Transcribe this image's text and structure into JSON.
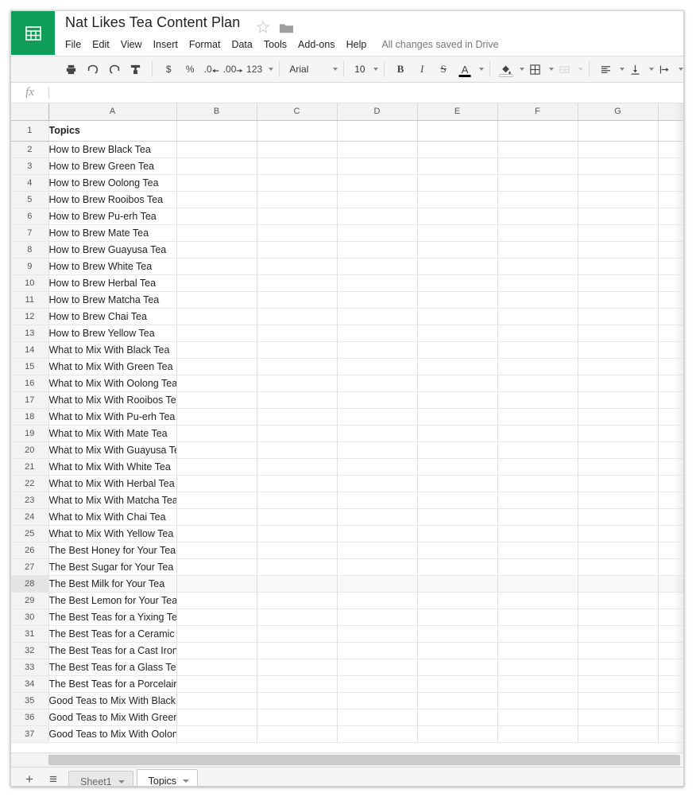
{
  "header": {
    "logo_icon": "sheets-grid-icon",
    "title": "Nat Likes Tea Content Plan",
    "star_icon": "star-outline-icon",
    "folder_icon": "folder-icon",
    "menus": [
      "File",
      "Edit",
      "View",
      "Insert",
      "Format",
      "Data",
      "Tools",
      "Add-ons",
      "Help"
    ],
    "save_status": "All changes saved in Drive"
  },
  "toolbar": {
    "print_icon": "print-icon",
    "undo_icon": "undo-icon",
    "redo_icon": "redo-icon",
    "paint_format_icon": "paint-format-icon",
    "currency_label": "$",
    "percent_label": "%",
    "decrease_decimal_label": ".0",
    "increase_decimal_label": ".00",
    "number_format_label": "123",
    "font_name": "Arial",
    "font_size": "10",
    "bold_label": "B",
    "italic_label": "I",
    "strikethrough_label": "S",
    "text_color_label": "A",
    "text_color_value": "#000000",
    "fill_color_icon": "fill-color-icon",
    "fill_color_value": "#ffffff",
    "borders_icon": "borders-icon",
    "merge_cells_icon": "merge-cells-icon",
    "horizontal_align_icon": "horizontal-align-icon",
    "vertical_align_icon": "vertical-align-icon",
    "text_wrap_icon": "text-wrapping-icon"
  },
  "formula_bar": {
    "fx_label": "fx",
    "value": "",
    "placeholder": ""
  },
  "grid": {
    "corner_label": "",
    "columns": [
      "A",
      "B",
      "C",
      "D",
      "E",
      "F",
      "G"
    ],
    "hover_row": 28,
    "rows": [
      {
        "n": "1",
        "a": "Topics"
      },
      {
        "n": "2",
        "a": "How to Brew Black Tea"
      },
      {
        "n": "3",
        "a": "How to Brew Green Tea"
      },
      {
        "n": "4",
        "a": "How to Brew Oolong Tea"
      },
      {
        "n": "5",
        "a": "How to Brew Rooibos Tea"
      },
      {
        "n": "6",
        "a": "How to Brew Pu-erh Tea"
      },
      {
        "n": "7",
        "a": "How to Brew Mate Tea"
      },
      {
        "n": "8",
        "a": "How to Brew Guayusa Tea"
      },
      {
        "n": "9",
        "a": "How to Brew White Tea"
      },
      {
        "n": "10",
        "a": "How to Brew Herbal Tea"
      },
      {
        "n": "11",
        "a": "How to Brew Matcha Tea"
      },
      {
        "n": "12",
        "a": "How to Brew Chai Tea"
      },
      {
        "n": "13",
        "a": "How to Brew Yellow Tea"
      },
      {
        "n": "14",
        "a": "What to Mix With Black Tea"
      },
      {
        "n": "15",
        "a": "What to Mix With Green Tea"
      },
      {
        "n": "16",
        "a": "What to Mix With Oolong Tea"
      },
      {
        "n": "17",
        "a": "What to Mix With Rooibos Tea"
      },
      {
        "n": "18",
        "a": "What to Mix With Pu-erh Tea"
      },
      {
        "n": "19",
        "a": "What to Mix With Mate Tea"
      },
      {
        "n": "20",
        "a": "What to Mix With Guayusa Tea"
      },
      {
        "n": "21",
        "a": "What to Mix With White Tea"
      },
      {
        "n": "22",
        "a": "What to Mix With Herbal Tea"
      },
      {
        "n": "23",
        "a": "What to Mix With Matcha Tea"
      },
      {
        "n": "24",
        "a": "What to Mix With Chai Tea"
      },
      {
        "n": "25",
        "a": "What to Mix With Yellow Tea"
      },
      {
        "n": "26",
        "a": "The Best Honey for Your Tea"
      },
      {
        "n": "27",
        "a": "The Best Sugar for Your Tea"
      },
      {
        "n": "28",
        "a": "The Best Milk for Your Tea"
      },
      {
        "n": "29",
        "a": "The Best Lemon for Your Tea"
      },
      {
        "n": "30",
        "a": "The Best Teas for a Yixing Teapot"
      },
      {
        "n": "31",
        "a": "The Best Teas for a Ceramic Teapot"
      },
      {
        "n": "32",
        "a": "The Best Teas for a Cast Iron Teapot"
      },
      {
        "n": "33",
        "a": "The Best Teas for a Glass Teapot"
      },
      {
        "n": "34",
        "a": "The Best Teas for a Porcelain Teapot"
      },
      {
        "n": "35",
        "a": "Good Teas to Mix With Black Tea"
      },
      {
        "n": "36",
        "a": "Good Teas to Mix With Green Tea"
      },
      {
        "n": "37",
        "a": "Good Teas to Mix With Oolong Tea"
      }
    ]
  },
  "tabbar": {
    "add_sheet_label": "+",
    "all_sheets_label": "≡",
    "tabs": [
      {
        "label": "Sheet1",
        "active": false
      },
      {
        "label": "Topics",
        "active": true
      }
    ]
  }
}
